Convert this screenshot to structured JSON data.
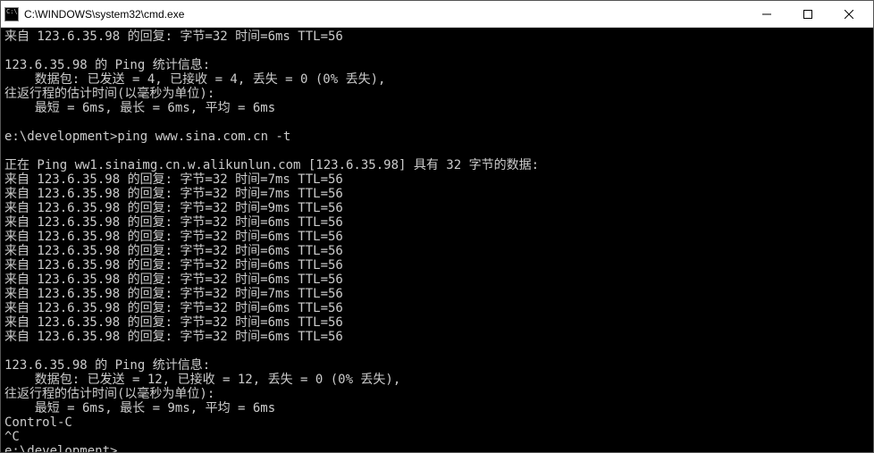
{
  "titlebar": {
    "text": "C:\\WINDOWS\\system32\\cmd.exe"
  },
  "terminal": {
    "lines": [
      "来自 123.6.35.98 的回复: 字节=32 时间=6ms TTL=56",
      "",
      "123.6.35.98 的 Ping 统计信息:",
      "    数据包: 已发送 = 4, 已接收 = 4, 丢失 = 0 (0% 丢失),",
      "往返行程的估计时间(以毫秒为单位):",
      "    最短 = 6ms, 最长 = 6ms, 平均 = 6ms",
      "",
      "e:\\development>ping www.sina.com.cn -t",
      "",
      "正在 Ping ww1.sinaimg.cn.w.alikunlun.com [123.6.35.98] 具有 32 字节的数据:",
      "来自 123.6.35.98 的回复: 字节=32 时间=7ms TTL=56",
      "来自 123.6.35.98 的回复: 字节=32 时间=7ms TTL=56",
      "来自 123.6.35.98 的回复: 字节=32 时间=9ms TTL=56",
      "来自 123.6.35.98 的回复: 字节=32 时间=6ms TTL=56",
      "来自 123.6.35.98 的回复: 字节=32 时间=6ms TTL=56",
      "来自 123.6.35.98 的回复: 字节=32 时间=6ms TTL=56",
      "来自 123.6.35.98 的回复: 字节=32 时间=6ms TTL=56",
      "来自 123.6.35.98 的回复: 字节=32 时间=6ms TTL=56",
      "来自 123.6.35.98 的回复: 字节=32 时间=7ms TTL=56",
      "来自 123.6.35.98 的回复: 字节=32 时间=6ms TTL=56",
      "来自 123.6.35.98 的回复: 字节=32 时间=6ms TTL=56",
      "来自 123.6.35.98 的回复: 字节=32 时间=6ms TTL=56",
      "",
      "123.6.35.98 的 Ping 统计信息:",
      "    数据包: 已发送 = 12, 已接收 = 12, 丢失 = 0 (0% 丢失),",
      "往返行程的估计时间(以毫秒为单位):",
      "    最短 = 6ms, 最长 = 9ms, 平均 = 6ms",
      "Control-C",
      "^C",
      "e:\\development>"
    ]
  }
}
